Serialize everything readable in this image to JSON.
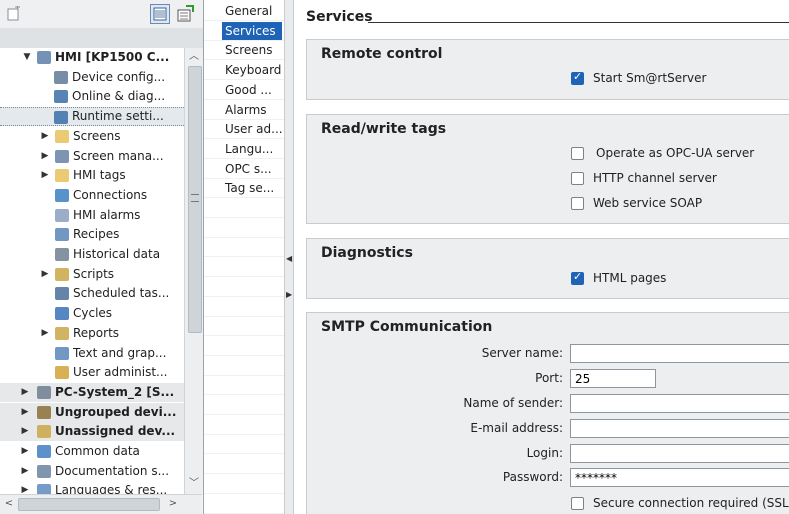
{
  "tree": {
    "items": [
      {
        "label": "HMI [KP1500 C...",
        "arrow": "▼",
        "bold": true,
        "icon": "hmi-device-icon"
      },
      {
        "label": "Device config...",
        "arrow": "",
        "bold": false,
        "icon": "device-config-icon"
      },
      {
        "label": "Online & diag...",
        "arrow": "",
        "bold": false,
        "icon": "online-diagnostics-icon"
      },
      {
        "label": "Runtime setti...",
        "arrow": "",
        "bold": false,
        "icon": "runtime-settings-icon"
      },
      {
        "label": "Screens",
        "arrow": "▶",
        "bold": false,
        "icon": "folder-icon"
      },
      {
        "label": "Screen mana...",
        "arrow": "▶",
        "bold": false,
        "icon": "screen-management-icon"
      },
      {
        "label": "HMI tags",
        "arrow": "▶",
        "bold": false,
        "icon": "folder-icon"
      },
      {
        "label": "Connections",
        "arrow": "",
        "bold": false,
        "icon": "connections-icon"
      },
      {
        "label": "HMI alarms",
        "arrow": "",
        "bold": false,
        "icon": "alarms-icon"
      },
      {
        "label": "Recipes",
        "arrow": "",
        "bold": false,
        "icon": "recipes-icon"
      },
      {
        "label": "Historical data",
        "arrow": "",
        "bold": false,
        "icon": "historical-data-icon"
      },
      {
        "label": "Scripts",
        "arrow": "▶",
        "bold": false,
        "icon": "scripts-icon"
      },
      {
        "label": "Scheduled tas...",
        "arrow": "",
        "bold": false,
        "icon": "scheduled-tasks-icon"
      },
      {
        "label": "Cycles",
        "arrow": "",
        "bold": false,
        "icon": "cycles-icon"
      },
      {
        "label": "Reports",
        "arrow": "▶",
        "bold": false,
        "icon": "reports-icon"
      },
      {
        "label": "Text and grap...",
        "arrow": "",
        "bold": false,
        "icon": "text-graphics-icon"
      },
      {
        "label": "User administ...",
        "arrow": "",
        "bold": false,
        "icon": "user-admin-icon"
      },
      {
        "label": "PC-System_2 [S...",
        "arrow": "▶",
        "bold": true,
        "icon": "pc-system-icon"
      },
      {
        "label": "Ungrouped devi...",
        "arrow": "▶",
        "bold": true,
        "icon": "ungrouped-devices-icon"
      },
      {
        "label": "Unassigned dev...",
        "arrow": "▶",
        "bold": true,
        "icon": "unassigned-devices-icon"
      },
      {
        "label": "Common data",
        "arrow": "▶",
        "bold": false,
        "icon": "common-data-icon"
      },
      {
        "label": "Documentation s...",
        "arrow": "▶",
        "bold": false,
        "icon": "documentation-icon"
      },
      {
        "label": "Languages & res...",
        "arrow": "▶",
        "bold": false,
        "icon": "languages-icon"
      }
    ]
  },
  "nav": {
    "items": [
      "General",
      "Services",
      "Screens",
      "Keyboard",
      "Good ...",
      "Alarms",
      "User ad...",
      "Langu...",
      "OPC s...",
      "Tag se..."
    ],
    "selected": "Services"
  },
  "main": {
    "title": "Services",
    "remote_control": {
      "title": "Remote control",
      "start_smartserver": {
        "label": "Start Sm@rtServer",
        "checked": true
      }
    },
    "readwrite": {
      "title": "Read/write tags",
      "opc_ua": {
        "label": "Operate as OPC-UA server",
        "checked": false
      },
      "http": {
        "label": "HTTP channel server",
        "checked": false
      },
      "soap": {
        "label": "Web service SOAP",
        "checked": false
      }
    },
    "diagnostics": {
      "title": "Diagnostics",
      "html_pages": {
        "label": "HTML pages",
        "checked": true
      }
    },
    "smtp": {
      "title": "SMTP Communication",
      "server_name": {
        "label": "Server name:",
        "value": ""
      },
      "port": {
        "label": "Port:",
        "value": "25"
      },
      "sender": {
        "label": "Name of sender:",
        "value": ""
      },
      "email": {
        "label": "E-mail address:",
        "value": ""
      },
      "login": {
        "label": "Login:",
        "value": ""
      },
      "password": {
        "label": "Password:",
        "value": "*******"
      },
      "ssl": {
        "label": "Secure connection required (SSL)",
        "checked": false
      }
    }
  },
  "colors": {
    "selection": "#1e63b6",
    "group_bg": "#eceeef"
  }
}
